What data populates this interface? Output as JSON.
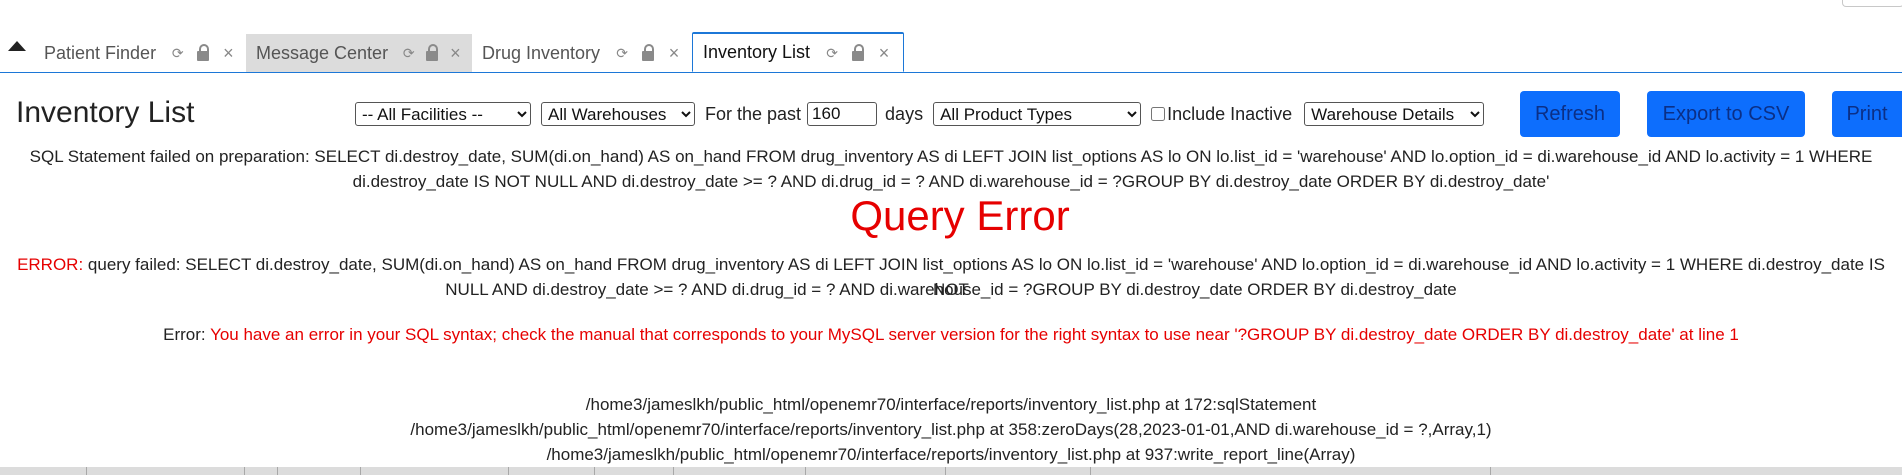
{
  "tabs": [
    {
      "label": "Patient Finder",
      "active": false
    },
    {
      "label": "Message Center",
      "active": false
    },
    {
      "label": "Drug Inventory",
      "active": false
    },
    {
      "label": "Inventory List",
      "active": true
    }
  ],
  "icons": {
    "collapse": "collapse-up-icon",
    "refresh": "refresh-icon",
    "lock": "lock-icon",
    "close": "close-icon"
  },
  "page": {
    "title": "Inventory List"
  },
  "filters": {
    "facility": "-- All Facilities --",
    "warehouse": "All Warehouses",
    "for_the_past_label": "For the past",
    "days_value": "160",
    "days_label": "days",
    "product_type": "All Product Types",
    "include_inactive_label": "Include Inactive",
    "include_inactive_checked": false,
    "details": "Warehouse Details"
  },
  "buttons": {
    "refresh": "Refresh",
    "export_csv": "Export to CSV",
    "print": "Print"
  },
  "messages": {
    "sql_failed_line1": "SQL Statement failed on preparation: SELECT di.destroy_date, SUM(di.on_hand) AS on_hand FROM drug_inventory AS di LEFT JOIN list_options AS lo ON lo.list_id = 'warehouse' AND lo.option_id = di.warehouse_id AND lo.activity = 1 WHERE",
    "sql_failed_line2": "di.destroy_date IS NOT NULL AND di.destroy_date >= ? AND di.drug_id = ? AND di.warehouse_id = ?GROUP BY di.destroy_date ORDER BY di.destroy_date'",
    "query_error_title": "Query Error",
    "error_label": "ERROR:",
    "error_line1": "query failed: SELECT di.destroy_date, SUM(di.on_hand) AS on_hand FROM drug_inventory AS di LEFT JOIN list_options AS lo ON lo.list_id = 'warehouse' AND lo.option_id = di.warehouse_id AND lo.activity = 1 WHERE di.destroy_date IS NOT",
    "error_line2": "NULL AND di.destroy_date >= ? AND di.drug_id = ? AND di.warehouse_id = ?GROUP BY di.destroy_date ORDER BY di.destroy_date",
    "mysql_label": "Error:",
    "mysql_text": "You have an error in your SQL syntax; check the manual that corresponds to your MySQL server version for the right syntax to use near '?GROUP BY di.destroy_date ORDER BY di.destroy_date' at line 1",
    "trace": [
      "/home3/jameslkh/public_html/openemr70/interface/reports/inventory_list.php at 172:sqlStatement",
      "/home3/jameslkh/public_html/openemr70/interface/reports/inventory_list.php at 358:zeroDays(28,2023-01-01,AND di.warehouse_id = ?,Array,1)",
      "/home3/jameslkh/public_html/openemr70/interface/reports/inventory_list.php at 937:write_report_line(Array)"
    ]
  },
  "colors": {
    "accent": "#0d6efd",
    "tab_border": "#1c77d7",
    "error_red": "#e60000"
  }
}
